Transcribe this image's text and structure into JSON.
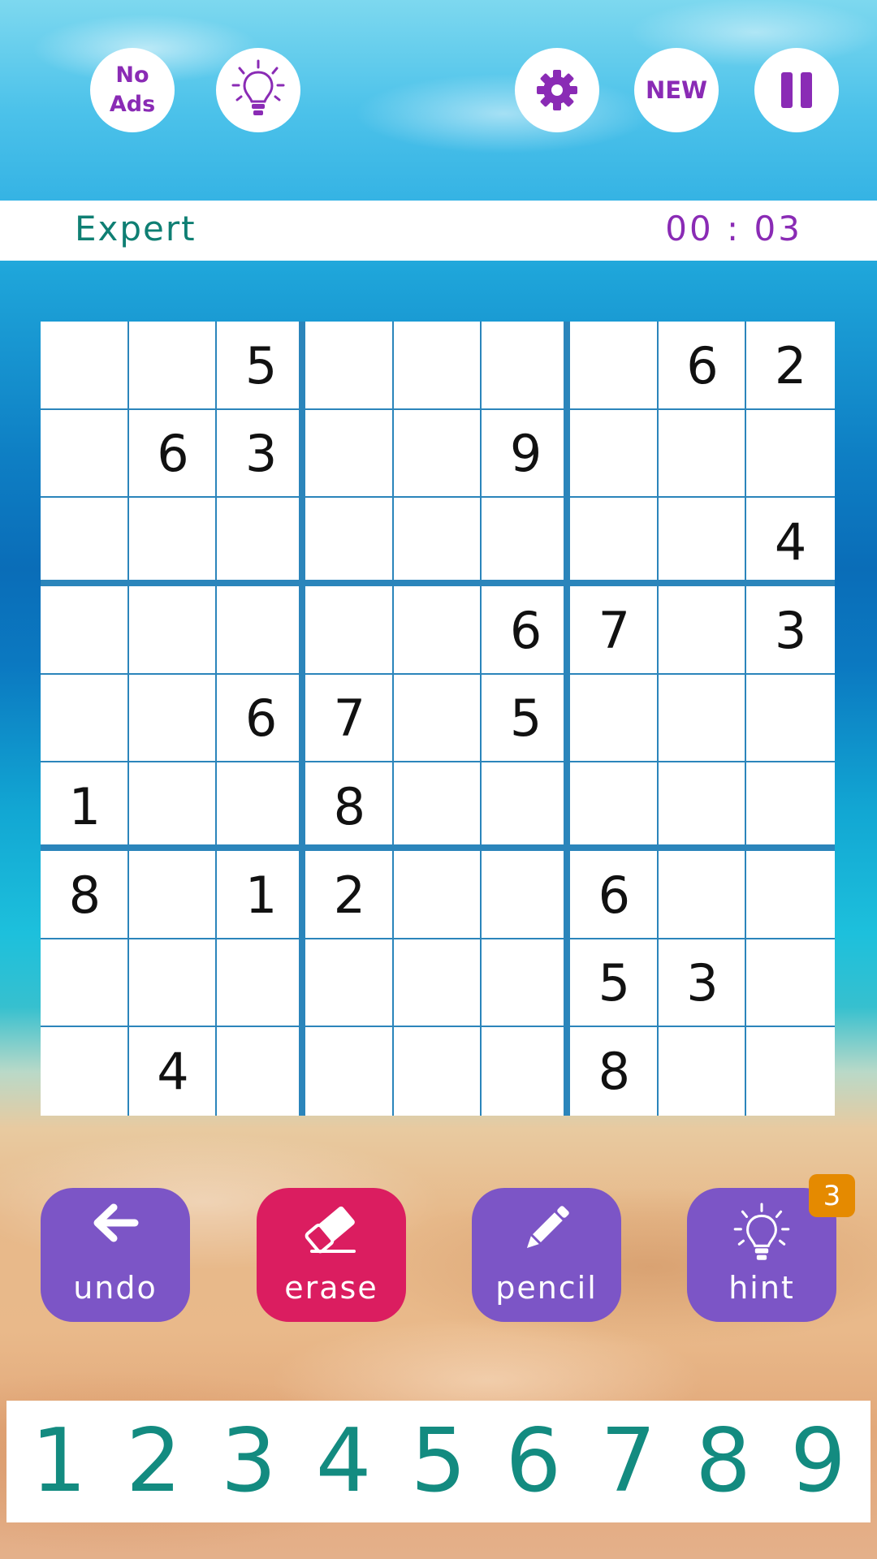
{
  "toolbar": {
    "no_ads_line1": "No",
    "no_ads_line2": "Ads",
    "idea_icon": "lightbulb-icon",
    "settings_icon": "gear-icon",
    "new_label": "NEW",
    "pause_icon": "pause-icon",
    "accent_color": "#8a2bb5"
  },
  "status": {
    "difficulty": "Expert",
    "timer": "00 : 03"
  },
  "grid": [
    [
      "",
      "",
      "5",
      "",
      "",
      "",
      "",
      "6",
      "2"
    ],
    [
      "",
      "6",
      "3",
      "",
      "",
      "9",
      "",
      "",
      ""
    ],
    [
      "",
      "",
      "",
      "",
      "",
      "",
      "",
      "",
      "4"
    ],
    [
      "",
      "",
      "",
      "",
      "",
      "6",
      "7",
      "",
      "3"
    ],
    [
      "",
      "",
      "6",
      "7",
      "",
      "5",
      "",
      "",
      ""
    ],
    [
      "1",
      "",
      "",
      "8",
      "",
      "",
      "",
      "",
      ""
    ],
    [
      "8",
      "",
      "1",
      "2",
      "",
      "",
      "6",
      "",
      ""
    ],
    [
      "",
      "",
      "",
      "",
      "",
      "",
      "5",
      "3",
      ""
    ],
    [
      "",
      "4",
      "",
      "",
      "",
      "",
      "8",
      "",
      ""
    ]
  ],
  "tools": {
    "undo_label": "undo",
    "erase_label": "erase",
    "pencil_label": "pencil",
    "hint_label": "hint",
    "hint_count": "3",
    "undo_icon": "arrow-left-icon",
    "erase_icon": "eraser-icon",
    "pencil_icon": "pencil-icon",
    "hint_icon": "lightbulb-icon",
    "tool_color": "#7c55c6",
    "erase_color": "#db1d60",
    "badge_color": "#e58a00"
  },
  "numpad": [
    "1",
    "2",
    "3",
    "4",
    "5",
    "6",
    "7",
    "8",
    "9"
  ]
}
